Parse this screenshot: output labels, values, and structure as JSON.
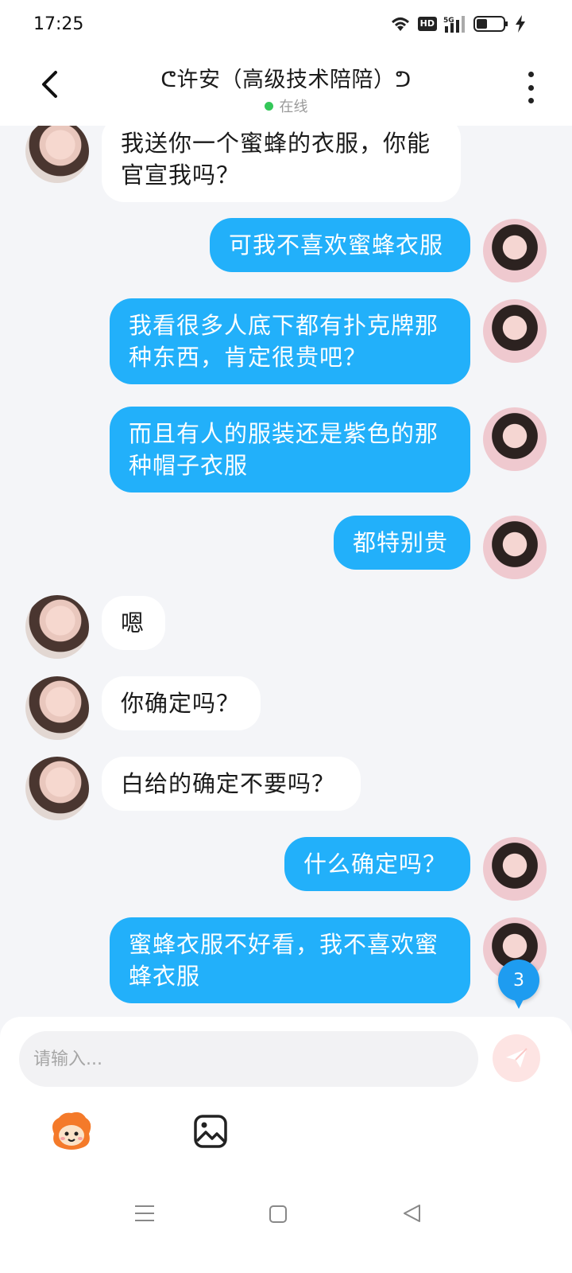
{
  "status_bar": {
    "time": "17:25",
    "hd_label": "HD",
    "network_label": "5G"
  },
  "header": {
    "title": "ᕦ许安（高级技术陪陪）ᕤ",
    "status": "在线"
  },
  "messages": [
    {
      "side": "in",
      "text_lines": [
        "我送你一个蜜蜂的衣服，你能",
        "官宣我吗？"
      ]
    },
    {
      "side": "out",
      "text_lines": [
        "可我不喜欢蜜蜂衣服"
      ]
    },
    {
      "side": "out",
      "text_lines": [
        "我看很多人底下都有扑克牌那",
        "种东西，肯定很贵吧？"
      ]
    },
    {
      "side": "out",
      "text_lines": [
        "而且有人的服装还是紫色的那",
        "种帽子衣服"
      ]
    },
    {
      "side": "out",
      "text_lines": [
        "都特别贵"
      ]
    },
    {
      "side": "in",
      "text_lines": [
        "嗯"
      ]
    },
    {
      "side": "in",
      "text_lines": [
        "你确定吗？"
      ]
    },
    {
      "side": "in",
      "text_lines": [
        "白给的确定不要吗？"
      ]
    },
    {
      "side": "out",
      "text_lines": [
        "什么确定吗？"
      ]
    },
    {
      "side": "out",
      "text_lines": [
        "蜜蜂衣服不好看，我不喜欢蜜",
        "蜂衣服"
      ]
    }
  ],
  "unread_badge": "3",
  "composer": {
    "placeholder": "请输入..."
  },
  "colors": {
    "outgoing_bubble": "#22b0fa",
    "incoming_bubble": "#ffffff",
    "online": "#34c759",
    "badge": "#1e9cf0",
    "send_button": "#fde4e3"
  }
}
